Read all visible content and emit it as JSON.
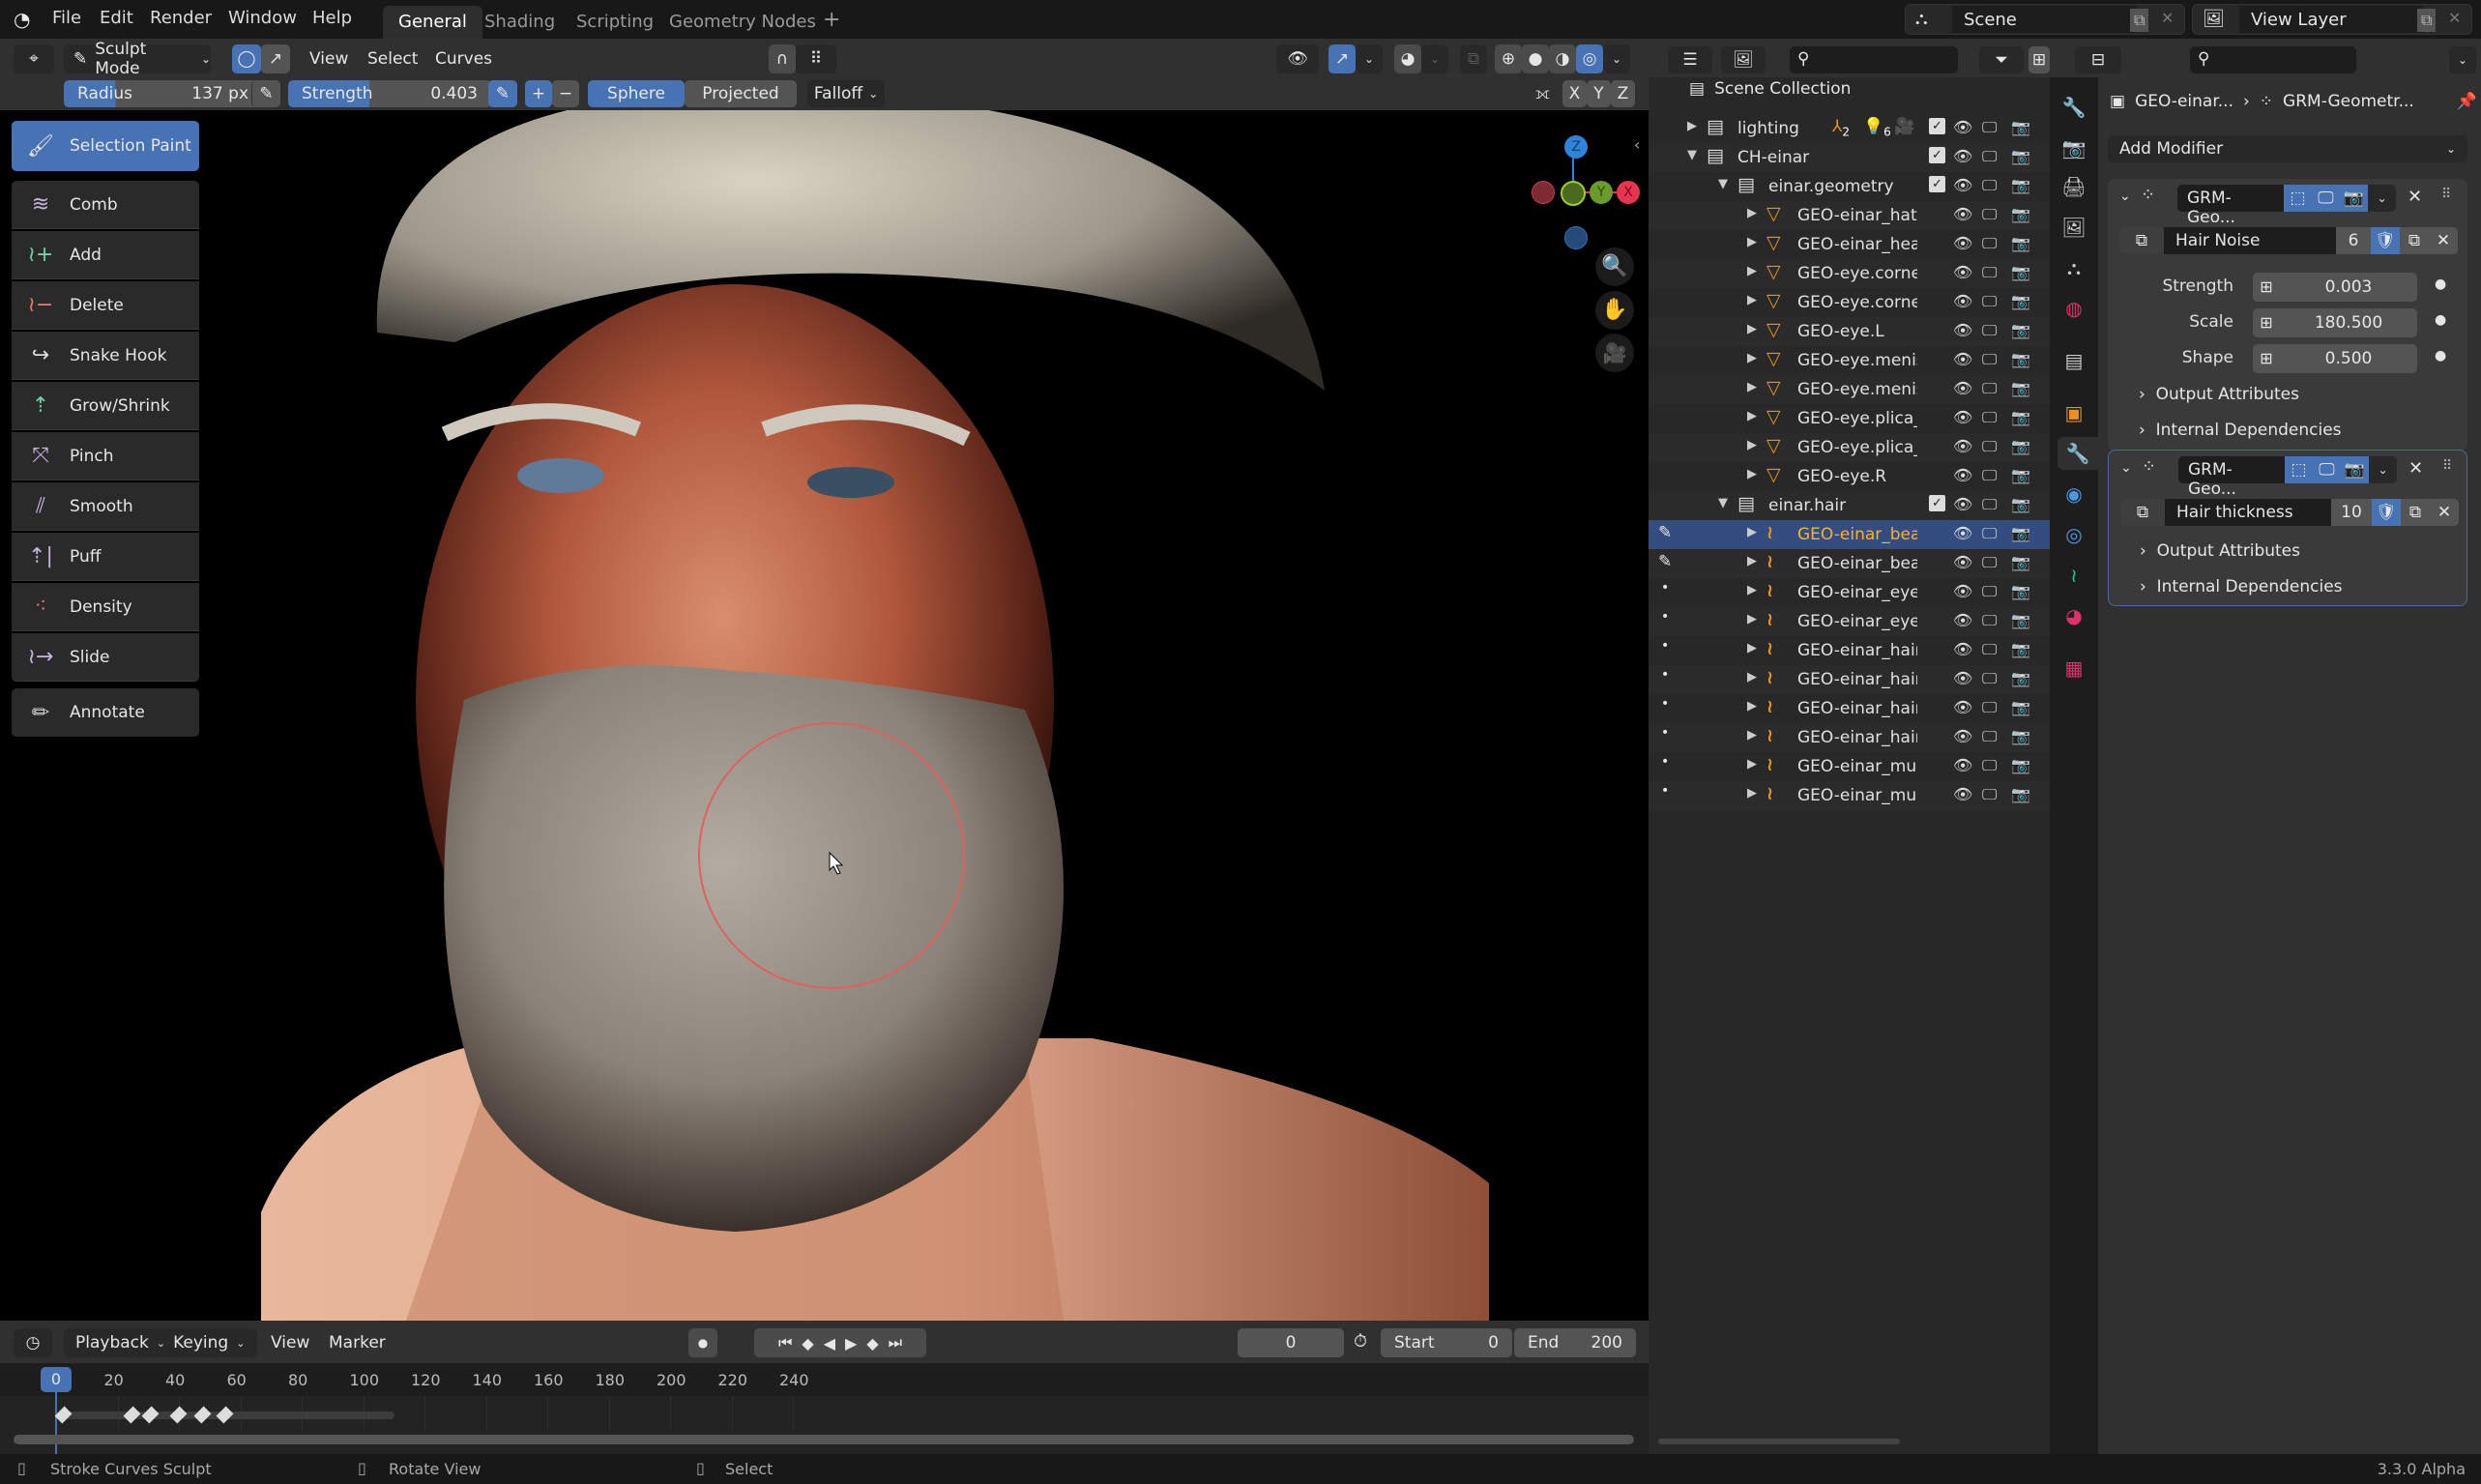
{
  "menubar": {
    "items": [
      "File",
      "Edit",
      "Render",
      "Window",
      "Help"
    ],
    "workspaces": [
      "General",
      "Shading",
      "Scripting",
      "Geometry Nodes"
    ],
    "active_workspace": "General",
    "add_workspace": "+",
    "scene": "Scene",
    "view_layer": "View Layer"
  },
  "viewport_header": {
    "mode": "Sculpt Mode",
    "menus": [
      "View",
      "Select",
      "Curves"
    ],
    "radius_label": "Radius",
    "radius_value": "137 px",
    "strength_label": "Strength",
    "strength_value": "0.403",
    "plus": "+",
    "minus": "−",
    "sphere": "Sphere",
    "projected": "Projected",
    "falloff": "Falloff",
    "axes": [
      "X",
      "Y",
      "Z"
    ]
  },
  "toolbar": {
    "active": "Selection Paint",
    "tools": [
      {
        "label": "Comb",
        "icon": "comb-icon"
      },
      {
        "label": "Add",
        "icon": "add-curves-icon"
      },
      {
        "label": "Delete",
        "icon": "delete-curves-icon"
      },
      {
        "label": "Snake Hook",
        "icon": "snake-hook-icon"
      },
      {
        "label": "Grow/Shrink",
        "icon": "grow-shrink-icon"
      },
      {
        "label": "Pinch",
        "icon": "pinch-icon"
      },
      {
        "label": "Smooth",
        "icon": "smooth-icon"
      },
      {
        "label": "Puff",
        "icon": "puff-icon"
      },
      {
        "label": "Density",
        "icon": "density-icon"
      },
      {
        "label": "Slide",
        "icon": "slide-icon"
      }
    ],
    "annotate": "Annotate"
  },
  "gizmo": {
    "x": "X",
    "y": "Y",
    "z": "Z",
    "colors": {
      "x": "#e8344f",
      "y": "#6b9c2a",
      "z": "#2e84d9"
    }
  },
  "timeline": {
    "menus": [
      "Playback",
      "Keying",
      "View",
      "Marker"
    ],
    "current_frame": "0",
    "start_label": "Start",
    "start": "0",
    "end_label": "End",
    "end": "200",
    "ticks": [
      "0",
      "20",
      "40",
      "60",
      "80",
      "100",
      "120",
      "140",
      "160",
      "180",
      "200",
      "220",
      "240"
    ],
    "keyframes": [
      0,
      25,
      31,
      40,
      48,
      55
    ]
  },
  "outliner": {
    "root": "Scene Collection",
    "rows": [
      {
        "name": "lighting",
        "type": "collection",
        "depth": 1,
        "expanded": false,
        "badges": [
          "2",
          "6"
        ]
      },
      {
        "name": "CH-einar",
        "type": "collection",
        "depth": 1,
        "expanded": true
      },
      {
        "name": "einar.geometry",
        "type": "collection",
        "depth": 2,
        "expanded": true
      },
      {
        "name": "GEO-einar_hat",
        "type": "mesh",
        "depth": 3
      },
      {
        "name": "GEO-einar_heac",
        "type": "mesh",
        "depth": 3
      },
      {
        "name": "GEO-eye.cornea",
        "type": "mesh",
        "depth": 3
      },
      {
        "name": "GEO-eye.cornea",
        "type": "mesh",
        "depth": 3
      },
      {
        "name": "GEO-eye.L",
        "type": "mesh",
        "depth": 3
      },
      {
        "name": "GEO-eye.menisc",
        "type": "mesh",
        "depth": 3
      },
      {
        "name": "GEO-eye.menisc",
        "type": "mesh",
        "depth": 3
      },
      {
        "name": "GEO-eye.plica_s",
        "type": "mesh",
        "depth": 3
      },
      {
        "name": "GEO-eye.plica_s",
        "type": "mesh",
        "depth": 3
      },
      {
        "name": "GEO-eye.R",
        "type": "mesh",
        "depth": 3
      },
      {
        "name": "einar.hair",
        "type": "collection",
        "depth": 2,
        "expanded": true
      },
      {
        "name": "GEO-einar_bear",
        "type": "curves",
        "depth": 3,
        "selected": true,
        "mode": "sculpt"
      },
      {
        "name": "GEO-einar_bear",
        "type": "curves",
        "depth": 3,
        "mode": "sculpt"
      },
      {
        "name": "GEO-einar_eyeb",
        "type": "curves",
        "depth": 3,
        "mode": "dot"
      },
      {
        "name": "GEO-einar_eyel",
        "type": "curves",
        "depth": 3,
        "mode": "dot"
      },
      {
        "name": "GEO-einar_hair",
        "type": "curves",
        "depth": 3,
        "mode": "dot"
      },
      {
        "name": "GEO-einar_hair.",
        "type": "curves",
        "depth": 3,
        "mode": "dot"
      },
      {
        "name": "GEO-einar_hair_",
        "type": "curves",
        "depth": 3,
        "mode": "dot"
      },
      {
        "name": "GEO-einar_hair_",
        "type": "curves",
        "depth": 3,
        "mode": "dot"
      },
      {
        "name": "GEO-einar_must",
        "type": "curves",
        "depth": 3,
        "mode": "dot"
      },
      {
        "name": "GEO-einar_must",
        "type": "curves",
        "depth": 3,
        "mode": "dot"
      }
    ]
  },
  "properties": {
    "breadcrumb_object": "GEO-einar...",
    "breadcrumb_modifier": "GRM-Geometr...",
    "add_modifier": "Add Modifier",
    "modifiers": [
      {
        "name": "GRM-Geo...",
        "node_group": "Hair Noise",
        "users": "6",
        "inputs": [
          {
            "label": "Strength",
            "value": "0.003"
          },
          {
            "label": "Scale",
            "value": "180.500"
          },
          {
            "label": "Shape",
            "value": "0.500"
          }
        ],
        "sub1": "Output Attributes",
        "sub2": "Internal Dependencies"
      },
      {
        "name": "GRM-Geo...",
        "node_group": "Hair thickness",
        "users": "10",
        "inputs": [],
        "sub1": "Output Attributes",
        "sub2": "Internal Dependencies"
      }
    ]
  },
  "status": {
    "left": "Stroke Curves Sculpt",
    "middle": "Rotate View",
    "right": "Select",
    "version": "3.3.0 Alpha"
  },
  "colors": {
    "accent": "#4772b3",
    "selected_row": "#334d80",
    "object_orange": "#e8941a",
    "brush_circle": "#e06060"
  }
}
